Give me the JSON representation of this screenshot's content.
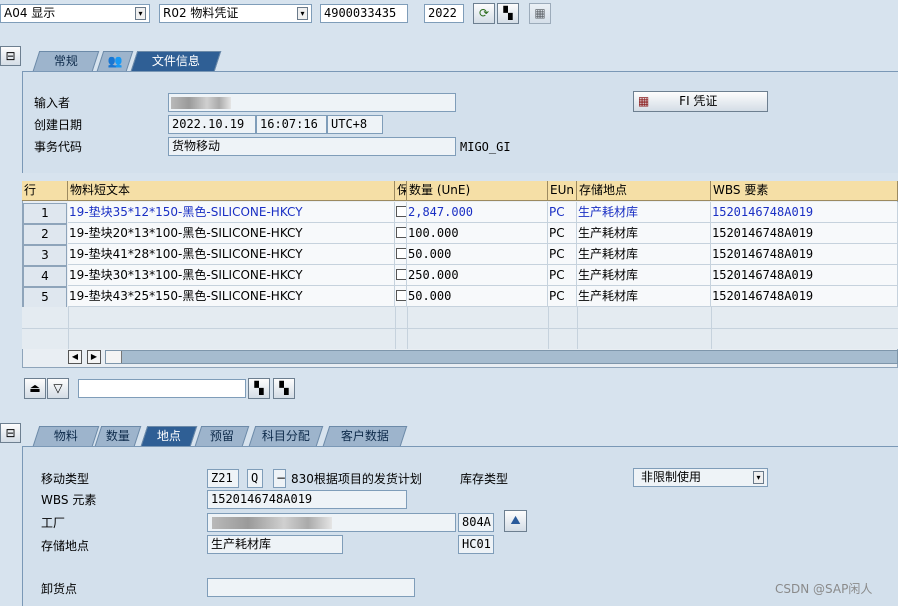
{
  "header": {
    "action": "A04 显示",
    "ref_doc": "R02 物料凭证",
    "doc_number": "4900033435",
    "year": "2022"
  },
  "doc_tabs": [
    "常规",
    "文件信息"
  ],
  "doc_info": {
    "entered_by_label": "输入者",
    "created_label": "创建日期",
    "created_date": "2022.10.19",
    "created_time": "16:07:16",
    "created_tz": "UTC+8",
    "tcode_label": "事务代码",
    "tcode_desc": "货物移动",
    "tcode": "MIGO_GI",
    "fi_button": "FI 凭证"
  },
  "table": {
    "headers": {
      "row": "行",
      "text": "物料短文本",
      "keep": "保",
      "qty": "数量 (UnE)",
      "eun": "EUn",
      "sloc": "存储地点",
      "wbs": "WBS 要素"
    },
    "rows": [
      {
        "no": "1",
        "text": "19-垫块35*12*150-黑色-SILICONE-HKCY",
        "qty": "2,847.000",
        "eun": "PC",
        "sloc": "生产耗材库",
        "wbs": "1520146748A019"
      },
      {
        "no": "2",
        "text": "19-垫块20*13*100-黑色-SILICONE-HKCY",
        "qty": "100.000",
        "eun": "PC",
        "sloc": "生产耗材库",
        "wbs": "1520146748A019"
      },
      {
        "no": "3",
        "text": "19-垫块41*28*100-黑色-SILICONE-HKCY",
        "qty": "50.000",
        "eun": "PC",
        "sloc": "生产耗材库",
        "wbs": "1520146748A019"
      },
      {
        "no": "4",
        "text": "19-垫块30*13*100-黑色-SILICONE-HKCY",
        "qty": "250.000",
        "eun": "PC",
        "sloc": "生产耗材库",
        "wbs": "1520146748A019"
      },
      {
        "no": "5",
        "text": "19-垫块43*25*150-黑色-SILICONE-HKCY",
        "qty": "50.000",
        "eun": "PC",
        "sloc": "生产耗材库",
        "wbs": "1520146748A019"
      }
    ]
  },
  "item_tabs": [
    "物料",
    "数量",
    "地点",
    "预留",
    "科目分配",
    "客户数据"
  ],
  "location": {
    "movement_type_label": "移动类型",
    "movement_type": "Z21",
    "movement_ind": "Q",
    "movement_desc": "830根据项目的发货计划",
    "stock_type_label": "库存类型",
    "stock_type": "非限制使用",
    "wbs_label": "WBS 元素",
    "wbs": "1520146748A019",
    "plant_label": "工厂",
    "plant_code": "804A",
    "sloc_label": "存储地点",
    "sloc": "生产耗材库",
    "sloc_code": "HC01",
    "unload_label": "卸货点"
  },
  "watermark": "CSDN @SAP闲人"
}
